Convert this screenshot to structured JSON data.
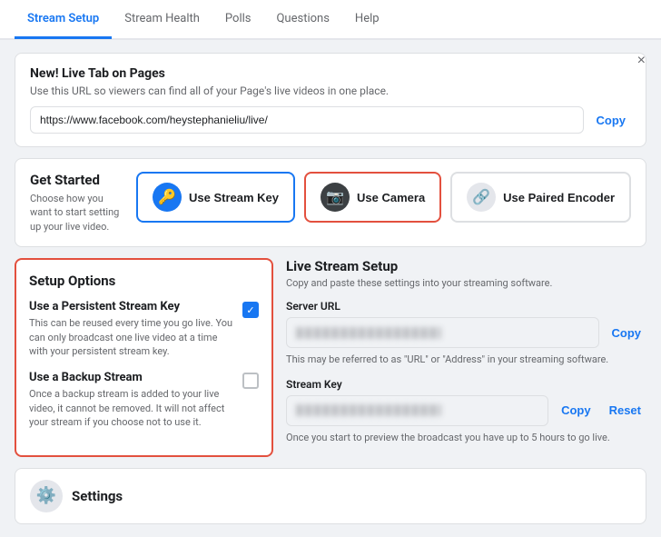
{
  "nav": {
    "tabs": [
      {
        "id": "stream-setup",
        "label": "Stream Setup",
        "active": true
      },
      {
        "id": "stream-health",
        "label": "Stream Health",
        "active": false
      },
      {
        "id": "polls",
        "label": "Polls",
        "active": false
      },
      {
        "id": "questions",
        "label": "Questions",
        "active": false
      },
      {
        "id": "help",
        "label": "Help",
        "active": false
      }
    ]
  },
  "banner": {
    "title": "New! Live Tab on Pages",
    "description": "Use this URL so viewers can find all of your Page's live videos in one place.",
    "url_value": "https://www.facebook.com/heystephanieliu/live/",
    "copy_label": "Copy",
    "close_label": "×"
  },
  "get_started": {
    "title": "Get Started",
    "description": "Choose how you want to start setting up your live video.",
    "options": [
      {
        "id": "stream-key",
        "label": "Use Stream Key",
        "icon": "🔑",
        "icon_bg": "blue",
        "active_border": "blue"
      },
      {
        "id": "camera",
        "label": "Use Camera",
        "icon": "📷",
        "icon_bg": "dark",
        "active_border": "red"
      },
      {
        "id": "paired-encoder",
        "label": "Use Paired Encoder",
        "icon": "🔗",
        "icon_bg": "light",
        "active_border": "none"
      }
    ]
  },
  "setup_options": {
    "title": "Setup Options",
    "options": [
      {
        "id": "persistent-stream-key",
        "title": "Use a Persistent Stream Key",
        "description": "This can be reused every time you go live. You can only broadcast one live video at a time with your persistent stream key.",
        "checked": true
      },
      {
        "id": "backup-stream",
        "title": "Use a Backup Stream",
        "description": "Once a backup stream is added to your live video, it cannot be removed. It will not affect your stream if you choose not to use it.",
        "checked": false
      }
    ]
  },
  "live_stream_setup": {
    "title": "Live Stream Setup",
    "subtitle": "Copy and paste these settings into your streaming software.",
    "server_url": {
      "label": "Server URL",
      "placeholder": "••••••••••••••••••••••••••••••••••",
      "copy_label": "Copy",
      "hint": "This may be referred to as \"URL\" or \"Address\" in your streaming software."
    },
    "stream_key": {
      "label": "Stream Key",
      "placeholder": "••••••••••••••••••••••••••••••••••••••••",
      "copy_label": "Copy",
      "reset_label": "Reset",
      "hint": "Once you start to preview the broadcast you have up to 5 hours to go live."
    }
  },
  "settings": {
    "label": "Settings"
  }
}
